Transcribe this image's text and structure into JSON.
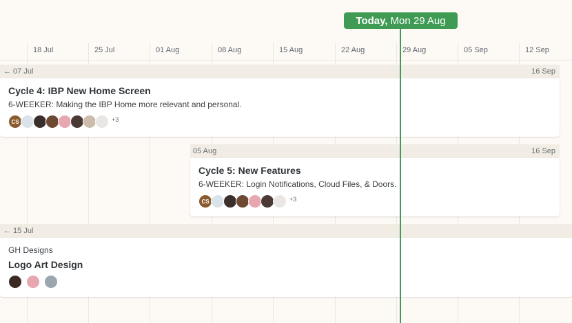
{
  "today": {
    "bold": "Today,",
    "date": "Mon 29 Aug"
  },
  "axis_dates": [
    "18 Jul",
    "25 Jul",
    "01 Aug",
    "08 Aug",
    "15 Aug",
    "22 Aug",
    "29 Aug",
    "05 Sep",
    "12 Sep"
  ],
  "rows": [
    {
      "range_start": "← 07 Jul",
      "range_end": "16 Sep",
      "title": "Cycle 4: IBP New Home Screen",
      "description": "6-WEEKER: Making the IBP Home more relevant and personal.",
      "avatar_initials": "CS",
      "more": "+3"
    },
    {
      "range_start": "05 Aug",
      "range_end": "16 Sep",
      "title": "Cycle 5: New Features",
      "description": "6-WEEKER: Login Notifications, Cloud Files, & Doors.",
      "avatar_initials": "CS",
      "more": "+3"
    },
    {
      "range_start": "← 15 Jul",
      "subtitle": "GH Designs",
      "title": "Logo Art Design"
    }
  ],
  "colors": {
    "today": "#3f9a54",
    "background": "#fdf9f5",
    "range_bar": "#f1ece4"
  }
}
